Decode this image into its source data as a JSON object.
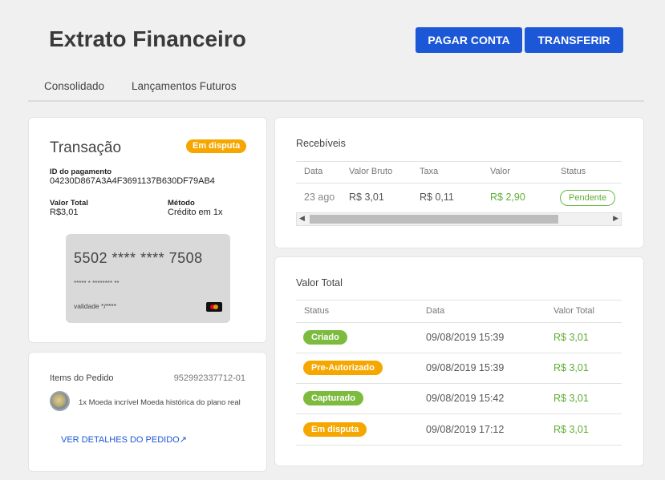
{
  "header": {
    "title": "Extrato Financeiro",
    "pay_label": "PAGAR CONTA",
    "transfer_label": "TRANSFERIR"
  },
  "tabs": [
    {
      "label": "Consolidado"
    },
    {
      "label": "Lançamentos Futuros"
    }
  ],
  "transaction": {
    "title": "Transação",
    "status_badge": "Em disputa",
    "payment_id_label": "ID do pagamento",
    "payment_id": "04230D867A3A4F3691137B630DF79AB4",
    "total_label": "Valor Total",
    "total_value": "R$3,01",
    "method_label": "Método",
    "method_value": "Crédito em 1x",
    "card": {
      "number": "5502 **** **** 7508",
      "holder": "***** * ******** **",
      "validity": "validade */****",
      "brand_icon": "mastercard-icon"
    }
  },
  "order_items": {
    "title": "Items do Pedido",
    "order_id": "952992337712-01",
    "item_text": "1x Moeda incrível Moeda histórica do plano real",
    "details_link": "VER DETALHES DO PEDIDO↗"
  },
  "receivables": {
    "title": "Recebíveis",
    "columns": [
      "Data",
      "Valor Bruto",
      "Taxa",
      "Valor",
      "Status"
    ],
    "row": {
      "date": "23 ago",
      "gross": "R$ 3,01",
      "fee": "R$ 0,11",
      "value": "R$ 2,90",
      "status": "Pendente"
    }
  },
  "total_history": {
    "title": "Valor Total",
    "columns": [
      "Status",
      "Data",
      "Valor Total"
    ],
    "rows": [
      {
        "status": "Criado",
        "date": "09/08/2019 15:39",
        "value": "R$ 3,01",
        "color": "#7dbb3f"
      },
      {
        "status": "Pre-Autorizado",
        "date": "09/08/2019 15:39",
        "value": "R$ 3,01",
        "color": "#f5a700"
      },
      {
        "status": "Capturado",
        "date": "09/08/2019 15:42",
        "value": "R$ 3,01",
        "color": "#7dbb3f"
      },
      {
        "status": "Em disputa",
        "date": "09/08/2019 17:12",
        "value": "R$ 3,01",
        "color": "#f5a700"
      }
    ]
  },
  "colors": {
    "primary": "#1b57d6",
    "success": "#5fae36",
    "warning": "#f5a700"
  }
}
